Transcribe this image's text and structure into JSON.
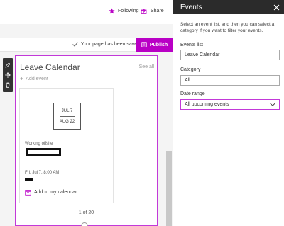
{
  "header": {
    "following_label": "Following",
    "share_label": "Share"
  },
  "savebar": {
    "saved_message": "Your page has been saved",
    "publish_label": "Publish"
  },
  "webpart": {
    "title": "Leave Calendar",
    "see_all": "See all",
    "add_event": "Add event",
    "event": {
      "start_date": "JUL 7",
      "end_date": "AUG 22",
      "location": "Working offsite",
      "datetime": "Fri, Jul 7, 8:00 AM",
      "add_to_calendar": "Add to my calendar"
    },
    "pager": "1 of 20"
  },
  "pane": {
    "title": "Events",
    "description": "Select an event list, and then you can select a category if you want to filter your events.",
    "events_list_label": "Events list",
    "events_list_value": "Leave Calendar",
    "category_label": "Category",
    "category_value": "All",
    "date_range_label": "Date range",
    "date_range_value": "All upcoming events"
  },
  "colors": {
    "accent": "#b900c5",
    "pane_header": "#2b2b2b"
  }
}
